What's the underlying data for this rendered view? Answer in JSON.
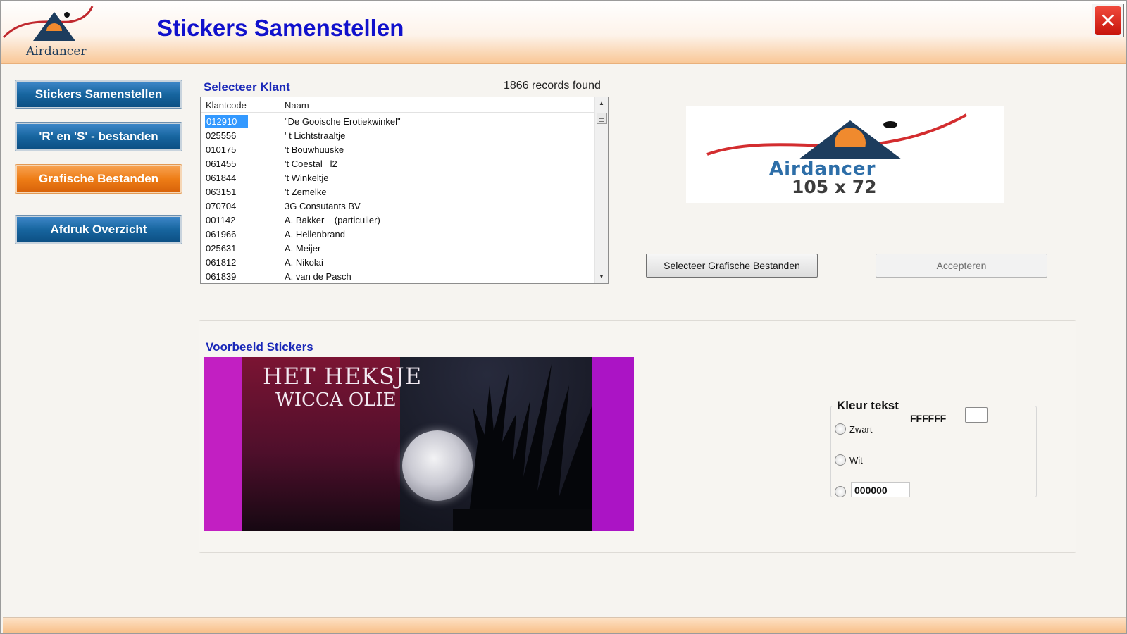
{
  "header": {
    "logo_text": "Airdancer",
    "title": "Stickers Samenstellen",
    "close_icon": "close-x-icon"
  },
  "nav": {
    "items": [
      {
        "label": "Stickers Samenstellen",
        "style": "blue"
      },
      {
        "label": "'R' en 'S' - bestanden",
        "style": "blue"
      },
      {
        "label": "Grafische Bestanden",
        "style": "orange"
      },
      {
        "label": "Afdruk Overzicht",
        "style": "blue"
      }
    ]
  },
  "customer": {
    "title": "Selecteer Klant",
    "records_found": "1866 records found",
    "columns": [
      "Klantcode",
      "Naam"
    ],
    "rows": [
      {
        "code": "012910",
        "name": "\"De Gooische Erotiekwinkel\"",
        "selected": true
      },
      {
        "code": "025556",
        "name": "' t Lichtstraaltje"
      },
      {
        "code": "010175",
        "name": "'t Bouwhuuske"
      },
      {
        "code": "061455",
        "name": "'t Coestal   l2"
      },
      {
        "code": "061844",
        "name": "'t Winkeltje"
      },
      {
        "code": "063151",
        "name": "'t Zemelke"
      },
      {
        "code": "070704",
        "name": "3G Consutants BV"
      },
      {
        "code": "001142",
        "name": "A. Bakker    (particulier)"
      },
      {
        "code": "061966",
        "name": "A. Hellenbrand"
      },
      {
        "code": "025631",
        "name": "A. Meijer"
      },
      {
        "code": "061812",
        "name": "A. Nikolai"
      },
      {
        "code": "061839",
        "name": "A. van de Pasch"
      }
    ]
  },
  "logo_preview": {
    "brand": "Airdancer",
    "size": "105 x 72"
  },
  "actions": {
    "select_graphics": "Selecteer Grafische Bestanden",
    "accept": "Accepteren"
  },
  "preview": {
    "title": "Voorbeeld Stickers",
    "sticker_line1": "HET HEKSJE",
    "sticker_line2": "WICCA OLIE",
    "background_color": "#c21fc2"
  },
  "text_color": {
    "title": "Kleur tekst",
    "hex_value": "FFFFFF",
    "swatch_color": "#FFFFFF",
    "options": [
      "Zwart",
      "Wit"
    ],
    "custom_value": "000000"
  },
  "colors": {
    "title_blue": "#1111cc",
    "nav_blue": "#17659f",
    "nav_orange": "#ee7d16",
    "selection": "#3399ff"
  }
}
